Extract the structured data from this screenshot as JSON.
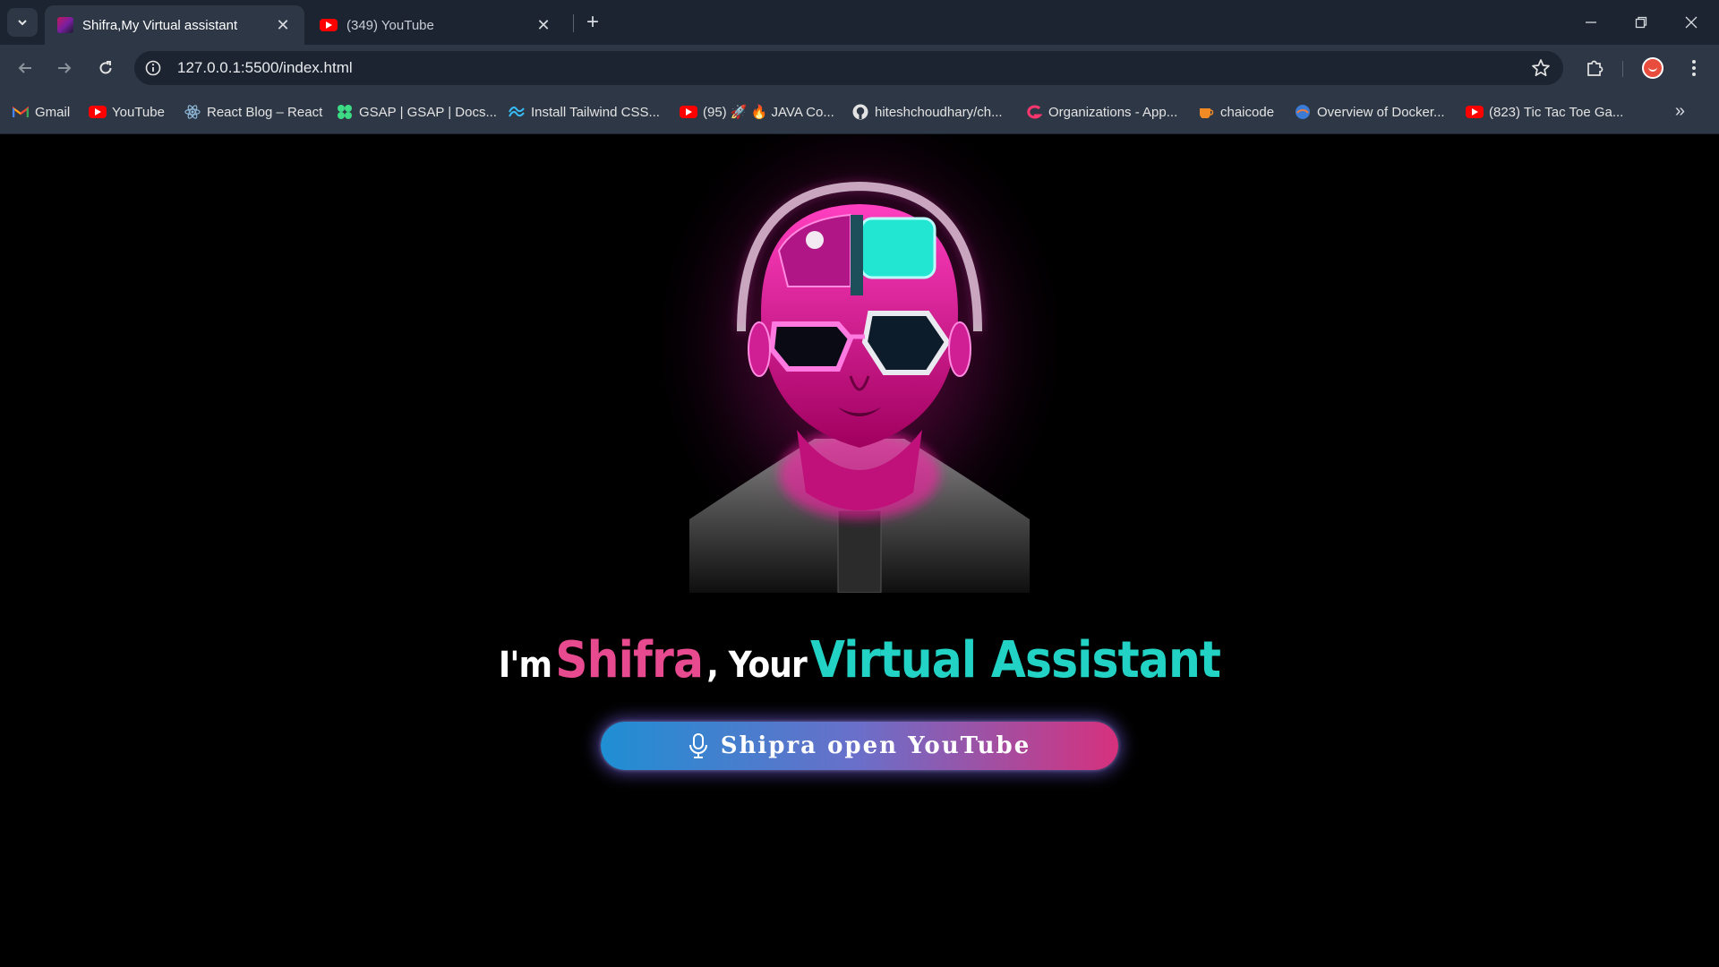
{
  "browser": {
    "tabs": [
      {
        "title": "Shifra,My Virtual assistant",
        "active": true,
        "icon": "shifra-favicon"
      },
      {
        "title": "(349) YouTube",
        "active": false,
        "icon": "youtube-favicon"
      }
    ],
    "url": "127.0.0.1:5500/index.html",
    "bookmarks": [
      {
        "label": "Gmail",
        "icon": "gmail-icon"
      },
      {
        "label": "YouTube",
        "icon": "youtube-icon"
      },
      {
        "label": "React Blog – React",
        "icon": "react-icon"
      },
      {
        "label": "GSAP | GSAP | Docs...",
        "icon": "gsap-icon"
      },
      {
        "label": "Install Tailwind CSS...",
        "icon": "tailwind-icon"
      },
      {
        "label": "(95) 🚀 🔥 JAVA Co...",
        "icon": "youtube-icon"
      },
      {
        "label": "hiteshchoudhary/ch...",
        "icon": "github-icon"
      },
      {
        "label": "Organizations - App...",
        "icon": "appwrite-icon"
      },
      {
        "label": "chaicode",
        "icon": "chaicode-icon"
      },
      {
        "label": "Overview of Docker...",
        "icon": "docker-icon"
      },
      {
        "label": "(823) Tic Tac Toe Ga...",
        "icon": "youtube-icon"
      }
    ]
  },
  "hero": {
    "image_alt": "Neon cyberpunk assistant avatar",
    "headline_im": "I'm",
    "headline_name": "Shifra",
    "headline_your": ", Your",
    "headline_role": "Virtual Assistant",
    "mic_button_label": "Shipra open YouTube"
  },
  "colors": {
    "accent_pink": "#e84a8f",
    "accent_cyan": "#22d3c5",
    "button_gradient": [
      "#1f8fd3",
      "#6a6fc9",
      "#d6317d"
    ]
  }
}
